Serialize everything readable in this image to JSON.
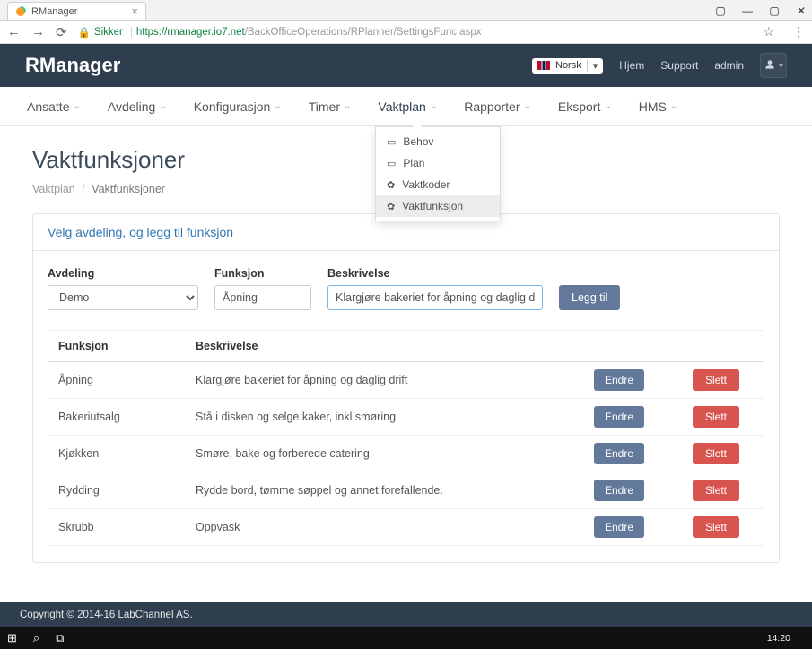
{
  "browser": {
    "tab_title": "RManager",
    "secure_label": "Sikker",
    "url_host": "https://rmanager.io7.net",
    "url_path": "/BackOfficeOperations/RPlanner/SettingsFunc.aspx"
  },
  "header": {
    "brand": "RManager",
    "language": "Norsk",
    "links": {
      "home": "Hjem",
      "support": "Support",
      "admin": "admin"
    }
  },
  "nav": {
    "ansatte": "Ansatte",
    "avdeling": "Avdeling",
    "konfigurasjon": "Konfigurasjon",
    "timer": "Timer",
    "vaktplan": "Vaktplan",
    "rapporter": "Rapporter",
    "eksport": "Eksport",
    "hms": "HMS"
  },
  "dropdown": {
    "behov": "Behov",
    "plan": "Plan",
    "vaktkoder": "Vaktkoder",
    "vaktfunksjon": "Vaktfunksjon"
  },
  "page": {
    "title": "Vaktfunksjoner",
    "breadcrumb_root": "Vaktplan",
    "breadcrumb_current": "Vaktfunksjoner",
    "panel_title": "Velg avdeling, og legg til funksjon"
  },
  "form": {
    "avdeling_label": "Avdeling",
    "avdeling_value": "Demo",
    "funksjon_label": "Funksjon",
    "funksjon_value": "Åpning",
    "beskrivelse_label": "Beskrivelse",
    "beskrivelse_value": "Klargjøre bakeriet for åpning og daglig drift",
    "add_button": "Legg til"
  },
  "table": {
    "headers": {
      "funksjon": "Funksjon",
      "beskrivelse": "Beskrivelse"
    },
    "edit_label": "Endre",
    "delete_label": "Slett",
    "rows": [
      {
        "funksjon": "Åpning",
        "beskrivelse": "Klargjøre bakeriet for åpning og daglig drift"
      },
      {
        "funksjon": "Bakeriutsalg",
        "beskrivelse": "Stå i disken og selge kaker, inkl smøring"
      },
      {
        "funksjon": "Kjøkken",
        "beskrivelse": "Smøre, bake og forberede catering"
      },
      {
        "funksjon": "Rydding",
        "beskrivelse": "Rydde bord, tømme søppel og annet forefallende."
      },
      {
        "funksjon": "Skrubb",
        "beskrivelse": "Oppvask"
      }
    ]
  },
  "footer": {
    "copyright": "Copyright © 2014-16 LabChannel AS."
  },
  "taskbar": {
    "time": "14.20"
  }
}
